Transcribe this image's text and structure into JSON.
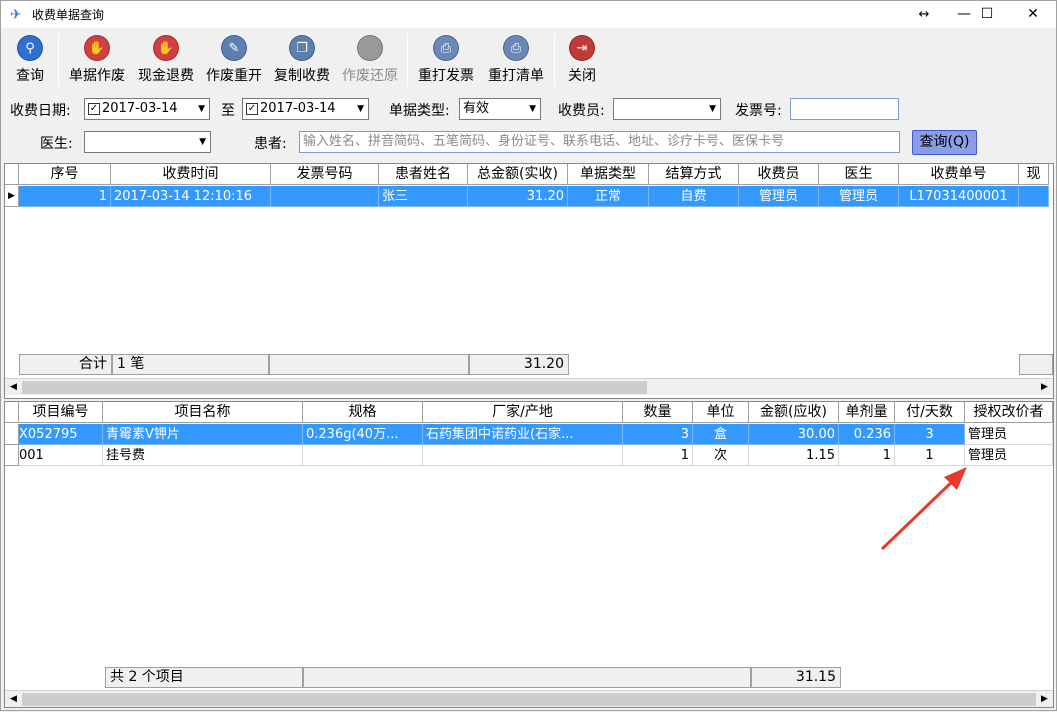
{
  "window": {
    "title": "收费单据查询",
    "controls": {
      "restore": "↔",
      "minimize": "—",
      "maximize": "☐",
      "close": "✕"
    }
  },
  "toolbar": [
    {
      "label": "查询",
      "icon": "magnifier-icon",
      "color": "#2f6fd0",
      "glyph": "⚲",
      "enabled": true
    },
    {
      "label": "单据作废",
      "icon": "hand-stop-icon",
      "color": "#d04040",
      "glyph": "✋",
      "enabled": true
    },
    {
      "label": "现金退费",
      "icon": "hand-stop-icon",
      "color": "#d04040",
      "glyph": "✋",
      "enabled": true
    },
    {
      "label": "作废重开",
      "icon": "edit-document-icon",
      "color": "#5a7fb0",
      "glyph": "✎",
      "enabled": true
    },
    {
      "label": "复制收费",
      "icon": "copy-icon",
      "color": "#5a7fb0",
      "glyph": "❐",
      "enabled": true
    },
    {
      "label": "作废还原",
      "icon": "disabled-circle-icon",
      "color": "#9a9a9a",
      "glyph": "",
      "enabled": false
    },
    {
      "label": "重打发票",
      "icon": "printer-icon",
      "color": "#6a88b8",
      "glyph": "⎙",
      "enabled": true
    },
    {
      "label": "重打清单",
      "icon": "printer-icon",
      "color": "#6a88b8",
      "glyph": "⎙",
      "enabled": true
    },
    {
      "label": "关闭",
      "icon": "exit-door-icon",
      "color": "#c03a3a",
      "glyph": "⇥",
      "enabled": true
    }
  ],
  "filters": {
    "date_label": "收费日期:",
    "date_from": "2017-03-14",
    "date_to_sep": "至",
    "date_to": "2017-03-14",
    "type_label": "单据类型:",
    "type_value": "有效",
    "cashier_label": "收费员:",
    "cashier_value": "",
    "invoice_label": "发票号:",
    "invoice_value": "",
    "doctor_label": "医生:",
    "doctor_value": "",
    "patient_label": "患者:",
    "patient_placeholder": "输入姓名、拼音简码、五笔简码、身份证号、联系电话、地址、诊疗卡号、医保卡号",
    "query_button": "查询(Q)"
  },
  "receipts": {
    "columns": [
      "序号",
      "收费时间",
      "发票号码",
      "患者姓名",
      "总金额(实收)",
      "单据类型",
      "结算方式",
      "收费员",
      "医生",
      "收费单号",
      "现"
    ],
    "rows": [
      [
        "1",
        "2017-03-14 12:10:16",
        "",
        "张三",
        "31.20",
        "正常",
        "自费",
        "管理员",
        "管理员",
        "L17031400001",
        ""
      ]
    ],
    "footer_label": "合计",
    "footer_count": "1 笔",
    "footer_total": "31.20"
  },
  "items": {
    "columns": [
      "项目编号",
      "项目名称",
      "规格",
      "厂家/产地",
      "数量",
      "单位",
      "金额(应收)",
      "单剂量",
      "付/天数",
      "授权改价者"
    ],
    "rows": [
      [
        "X052795",
        "青霉素V钾片",
        "0.236g(40万...",
        "石药集团中诺药业(石家...",
        "3",
        "盒",
        "30.00",
        "0.236",
        "3",
        "管理员"
      ],
      [
        "001",
        "挂号费",
        "",
        "",
        "1",
        "次",
        "1.15",
        "1",
        "1",
        "管理员"
      ]
    ],
    "footer_count": "共 2 个项目",
    "footer_total": "31.15"
  },
  "colors": {
    "selection": "#3399ff",
    "annotation_arrow": "#e8392b"
  }
}
